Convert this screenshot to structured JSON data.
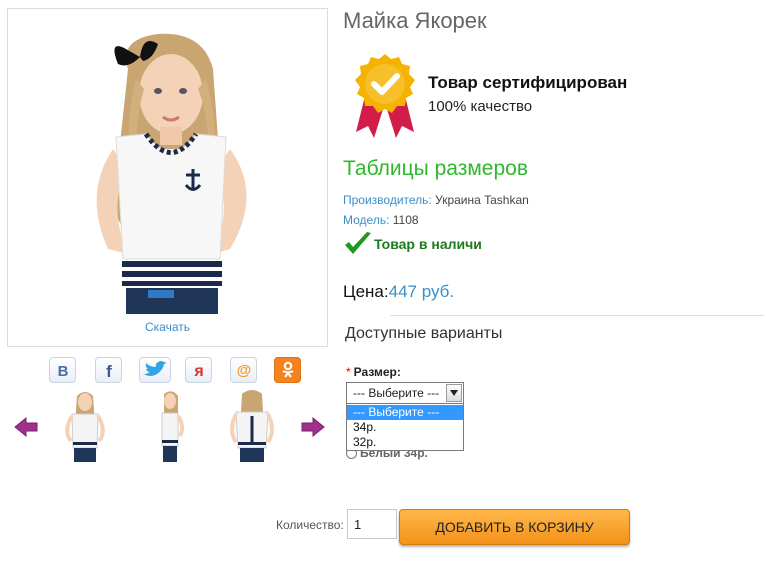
{
  "product": {
    "title": "Майка Якорек",
    "download_link": "Скачать",
    "certified_title": "Товар сертифицирован",
    "certified_subtitle": "100% качество",
    "size_tables_link": "Таблицы размеров",
    "manufacturer_label": "Производитель:",
    "manufacturer_value": "Украина Tashkan",
    "model_label": "Модель:",
    "model_value": "1108",
    "stock_status": "Товар в наличи",
    "price_label": "Цена:",
    "price_value": "447 руб."
  },
  "social": [
    {
      "name": "vkontakte",
      "glyph": "B",
      "color": "#4a6ea9"
    },
    {
      "name": "facebook",
      "glyph": "f",
      "color": "#3b5998"
    },
    {
      "name": "twitter",
      "glyph": "bird",
      "color": "#2fa4e7"
    },
    {
      "name": "moikrug",
      "glyph": "я",
      "color": "#e03030"
    },
    {
      "name": "mailru",
      "glyph": "@",
      "color": "#f39a1d"
    },
    {
      "name": "odnoklassniki",
      "glyph": "ok",
      "color": "#f58220"
    }
  ],
  "thumbnails": [
    "thumb-front",
    "thumb-side",
    "thumb-back"
  ],
  "options": {
    "section_title": "Доступные варианты",
    "size_label": "Размер:",
    "required_mark": "*",
    "selected_value": "--- Выберите ---",
    "dropdown_items": [
      "--- Выберите ---",
      "34р.",
      "32р."
    ],
    "hidden_option_text": "Белый 34р."
  },
  "cart": {
    "quantity_label": "Количество:",
    "quantity_value": "1",
    "add_button": "ДОБАВИТЬ В КОРЗИНУ"
  },
  "colors": {
    "accent_blue": "#3a8fc8",
    "green": "#2eb82e",
    "orange": "#f39219"
  }
}
